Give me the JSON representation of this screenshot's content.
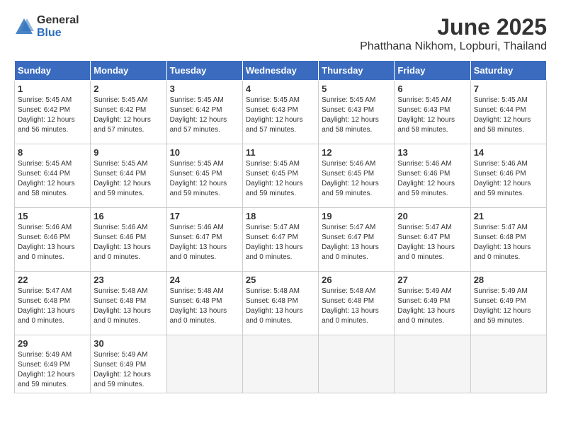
{
  "logo": {
    "text_general": "General",
    "text_blue": "Blue"
  },
  "title": "June 2025",
  "location": "Phatthana Nikhom, Lopburi, Thailand",
  "days_of_week": [
    "Sunday",
    "Monday",
    "Tuesday",
    "Wednesday",
    "Thursday",
    "Friday",
    "Saturday"
  ],
  "weeks": [
    [
      {
        "day": "1",
        "sunrise": "5:45 AM",
        "sunset": "6:42 PM",
        "daylight": "12 hours and 56 minutes."
      },
      {
        "day": "2",
        "sunrise": "5:45 AM",
        "sunset": "6:42 PM",
        "daylight": "12 hours and 57 minutes."
      },
      {
        "day": "3",
        "sunrise": "5:45 AM",
        "sunset": "6:42 PM",
        "daylight": "12 hours and 57 minutes."
      },
      {
        "day": "4",
        "sunrise": "5:45 AM",
        "sunset": "6:43 PM",
        "daylight": "12 hours and 57 minutes."
      },
      {
        "day": "5",
        "sunrise": "5:45 AM",
        "sunset": "6:43 PM",
        "daylight": "12 hours and 58 minutes."
      },
      {
        "day": "6",
        "sunrise": "5:45 AM",
        "sunset": "6:43 PM",
        "daylight": "12 hours and 58 minutes."
      },
      {
        "day": "7",
        "sunrise": "5:45 AM",
        "sunset": "6:44 PM",
        "daylight": "12 hours and 58 minutes."
      }
    ],
    [
      {
        "day": "8",
        "sunrise": "5:45 AM",
        "sunset": "6:44 PM",
        "daylight": "12 hours and 58 minutes."
      },
      {
        "day": "9",
        "sunrise": "5:45 AM",
        "sunset": "6:44 PM",
        "daylight": "12 hours and 59 minutes."
      },
      {
        "day": "10",
        "sunrise": "5:45 AM",
        "sunset": "6:45 PM",
        "daylight": "12 hours and 59 minutes."
      },
      {
        "day": "11",
        "sunrise": "5:45 AM",
        "sunset": "6:45 PM",
        "daylight": "12 hours and 59 minutes."
      },
      {
        "day": "12",
        "sunrise": "5:46 AM",
        "sunset": "6:45 PM",
        "daylight": "12 hours and 59 minutes."
      },
      {
        "day": "13",
        "sunrise": "5:46 AM",
        "sunset": "6:46 PM",
        "daylight": "12 hours and 59 minutes."
      },
      {
        "day": "14",
        "sunrise": "5:46 AM",
        "sunset": "6:46 PM",
        "daylight": "12 hours and 59 minutes."
      }
    ],
    [
      {
        "day": "15",
        "sunrise": "5:46 AM",
        "sunset": "6:46 PM",
        "daylight": "13 hours and 0 minutes."
      },
      {
        "day": "16",
        "sunrise": "5:46 AM",
        "sunset": "6:46 PM",
        "daylight": "13 hours and 0 minutes."
      },
      {
        "day": "17",
        "sunrise": "5:46 AM",
        "sunset": "6:47 PM",
        "daylight": "13 hours and 0 minutes."
      },
      {
        "day": "18",
        "sunrise": "5:47 AM",
        "sunset": "6:47 PM",
        "daylight": "13 hours and 0 minutes."
      },
      {
        "day": "19",
        "sunrise": "5:47 AM",
        "sunset": "6:47 PM",
        "daylight": "13 hours and 0 minutes."
      },
      {
        "day": "20",
        "sunrise": "5:47 AM",
        "sunset": "6:47 PM",
        "daylight": "13 hours and 0 minutes."
      },
      {
        "day": "21",
        "sunrise": "5:47 AM",
        "sunset": "6:48 PM",
        "daylight": "13 hours and 0 minutes."
      }
    ],
    [
      {
        "day": "22",
        "sunrise": "5:47 AM",
        "sunset": "6:48 PM",
        "daylight": "13 hours and 0 minutes."
      },
      {
        "day": "23",
        "sunrise": "5:48 AM",
        "sunset": "6:48 PM",
        "daylight": "13 hours and 0 minutes."
      },
      {
        "day": "24",
        "sunrise": "5:48 AM",
        "sunset": "6:48 PM",
        "daylight": "13 hours and 0 minutes."
      },
      {
        "day": "25",
        "sunrise": "5:48 AM",
        "sunset": "6:48 PM",
        "daylight": "13 hours and 0 minutes."
      },
      {
        "day": "26",
        "sunrise": "5:48 AM",
        "sunset": "6:48 PM",
        "daylight": "13 hours and 0 minutes."
      },
      {
        "day": "27",
        "sunrise": "5:49 AM",
        "sunset": "6:49 PM",
        "daylight": "13 hours and 0 minutes."
      },
      {
        "day": "28",
        "sunrise": "5:49 AM",
        "sunset": "6:49 PM",
        "daylight": "12 hours and 59 minutes."
      }
    ],
    [
      {
        "day": "29",
        "sunrise": "5:49 AM",
        "sunset": "6:49 PM",
        "daylight": "12 hours and 59 minutes."
      },
      {
        "day": "30",
        "sunrise": "5:49 AM",
        "sunset": "6:49 PM",
        "daylight": "12 hours and 59 minutes."
      },
      null,
      null,
      null,
      null,
      null
    ]
  ],
  "labels": {
    "sunrise": "Sunrise:",
    "sunset": "Sunset:",
    "daylight": "Daylight:"
  }
}
